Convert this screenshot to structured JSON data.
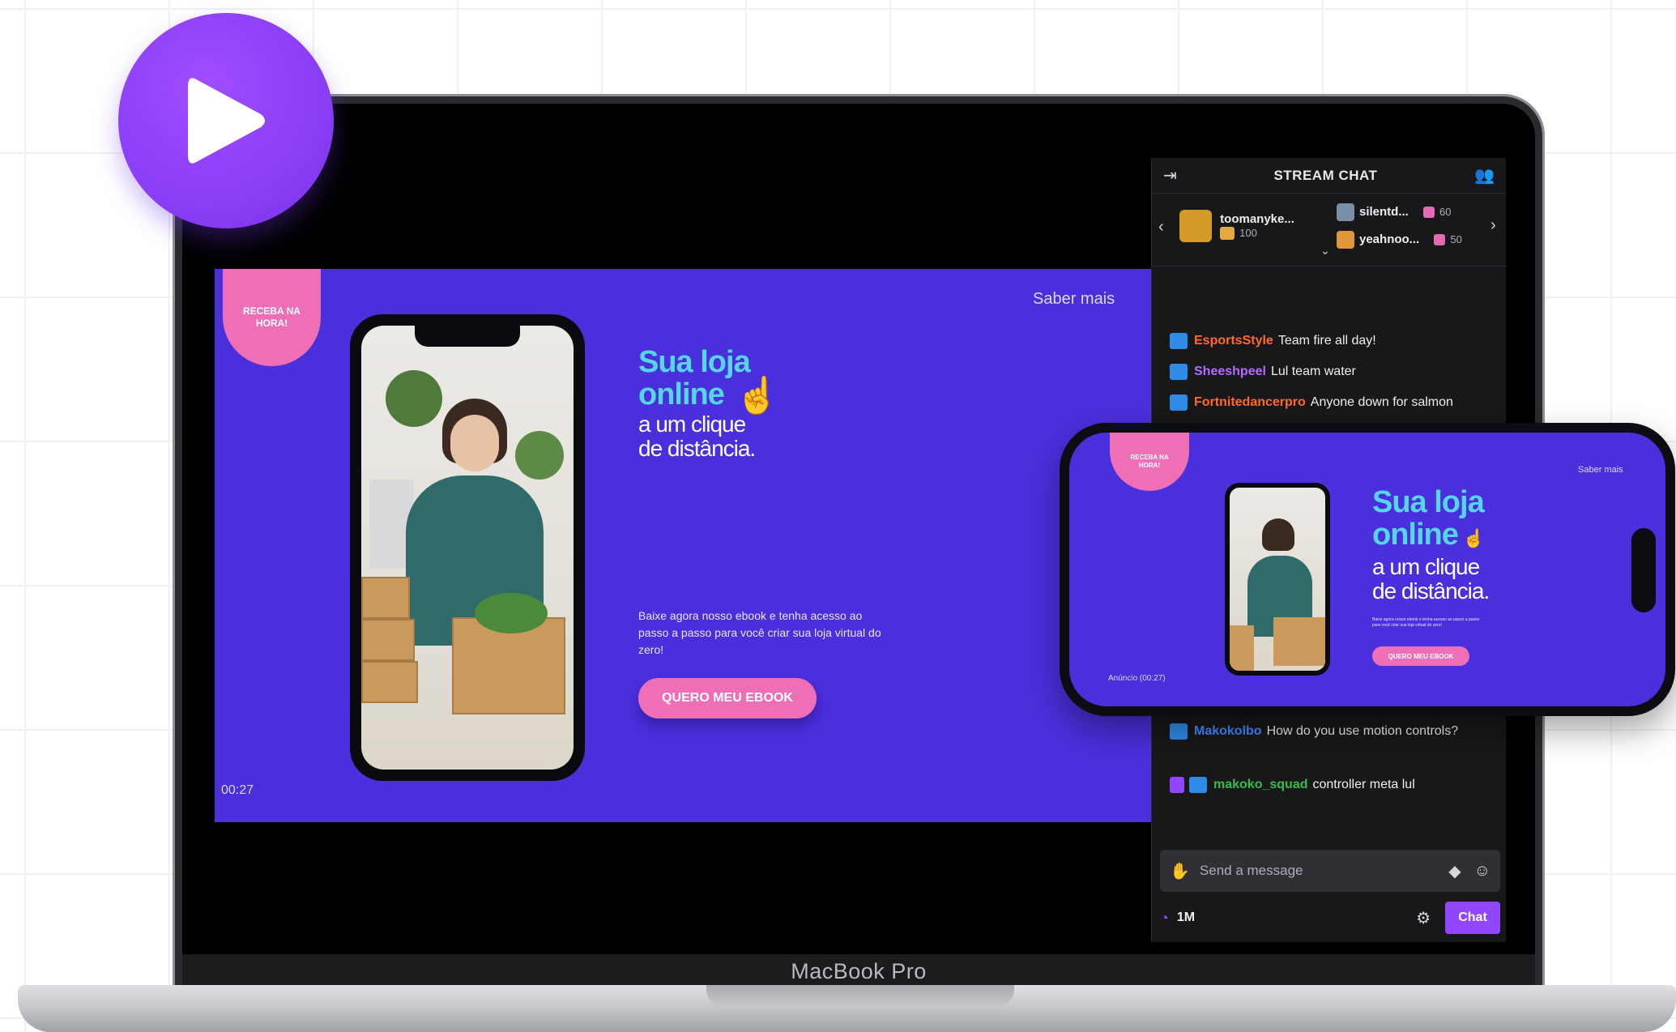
{
  "play_button": {
    "icon": "play-icon"
  },
  "laptop": {
    "label": "MacBook Pro"
  },
  "video": {
    "badge": "RECEBA NA HORA!",
    "saber_mais": "Saber mais",
    "headline_line1": "Sua loja",
    "headline_line2": "online",
    "headline_line3": "a um clique",
    "headline_line4": "de distância.",
    "subcopy": "Baixe agora nosso ebook e tenha acesso ao passo a passo para você criar sua loja virtual do zero!",
    "cta": "QUERO MEU EBOOK",
    "timer": "00:27"
  },
  "chat": {
    "title": "STREAM CHAT",
    "leaders": [
      {
        "name": "toomanyke...",
        "count": "100"
      },
      {
        "name": "silentd...",
        "count": "60"
      },
      {
        "name": "yeahnoo...",
        "count": "50"
      }
    ],
    "messages": [
      {
        "user": "EsportsStyle",
        "text": "Team fire all day!",
        "color": "#ff6a2c"
      },
      {
        "user": "Sheeshpeel",
        "text": "Lul team water",
        "color": "#b36cff"
      },
      {
        "user": "Fortnitedancerpro",
        "text": "Anyone down for salmon",
        "color": "#ff6a2c"
      },
      {
        "user": "Makokolbo",
        "text": "How do you use motion controls?",
        "color": "#3d8bff"
      },
      {
        "user": "makoko_squad",
        "text": "controller meta lul",
        "color": "#2fbf4a"
      }
    ],
    "input_placeholder": "Send a message",
    "points": "1M",
    "send_label": "Chat"
  },
  "mobile_preview": {
    "badge": "RECEBA NA HORA!",
    "saber_mais": "Saber mais",
    "headline_line1": "Sua loja",
    "headline_line2": "online",
    "headline_line3": "a um clique",
    "headline_line4": "de distância.",
    "subcopy": "Baixe agora nosso ebook e tenha acesso ao passo a passo para você criar sua loja virtual do zero!",
    "cta": "QUERO MEU EBOOK",
    "timer": "Anúncio (00:27)"
  },
  "colors": {
    "brand_purple": "#8a3ef6",
    "video_bg": "#4a2fdc",
    "headline_cyan": "#55d6e8",
    "cta_pink": "#ef6fb7",
    "chat_bg": "#18181b",
    "chat_accent": "#9146ff"
  }
}
